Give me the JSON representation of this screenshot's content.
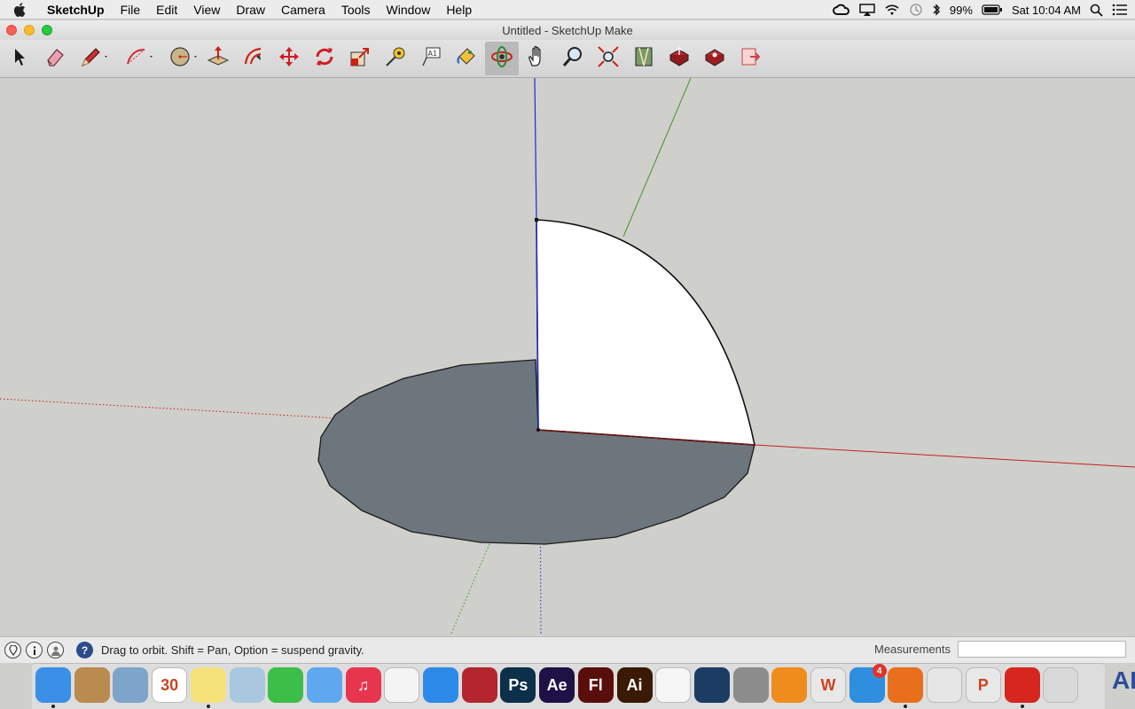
{
  "menubar": {
    "apple_icon": "apple-logo-icon",
    "app_name": "SketchUp",
    "items": [
      "File",
      "Edit",
      "View",
      "Draw",
      "Camera",
      "Tools",
      "Window",
      "Help"
    ],
    "status_icons": [
      "creative-cloud-icon",
      "airplay-icon",
      "wifi-icon",
      "time-machine-icon",
      "bluetooth-icon"
    ],
    "battery": "99%",
    "clock": "Sat 10:04 AM"
  },
  "window": {
    "title": "Untitled - SketchUp Make"
  },
  "toolbar": {
    "tools": [
      {
        "name": "select-tool",
        "icon": "arrow-pointer-icon",
        "active": false
      },
      {
        "name": "eraser-tool",
        "icon": "eraser-icon",
        "active": false
      },
      {
        "name": "pencil-line-tool",
        "icon": "pencil-icon",
        "active": false
      },
      {
        "name": "arc-tool",
        "icon": "arc-icon",
        "active": false
      },
      {
        "name": "circle-shapes-tool",
        "icon": "circle-icon",
        "active": false
      },
      {
        "name": "push-pull-tool",
        "icon": "push-pull-icon",
        "active": false
      },
      {
        "name": "offset-tool",
        "icon": "offset-icon",
        "active": false
      },
      {
        "name": "move-tool",
        "icon": "move-arrows-icon",
        "active": false
      },
      {
        "name": "rotate-tool",
        "icon": "rotate-icon",
        "active": false
      },
      {
        "name": "scale-tool",
        "icon": "scale-icon",
        "active": false
      },
      {
        "name": "tape-measure-tool",
        "icon": "tape-measure-icon",
        "active": false
      },
      {
        "name": "text-tool",
        "icon": "text-label-icon",
        "active": false
      },
      {
        "name": "paint-bucket-tool",
        "icon": "paint-bucket-icon",
        "active": false
      },
      {
        "name": "orbit-tool",
        "icon": "orbit-icon",
        "active": true
      },
      {
        "name": "pan-tool",
        "icon": "hand-icon",
        "active": false
      },
      {
        "name": "zoom-tool",
        "icon": "magnifier-icon",
        "active": false
      },
      {
        "name": "zoom-extents-tool",
        "icon": "zoom-extents-icon",
        "active": false
      },
      {
        "name": "warehouse-tool",
        "icon": "warehouse-icon",
        "active": false
      },
      {
        "name": "share-model-tool",
        "icon": "share-model-icon",
        "active": false
      },
      {
        "name": "extension-warehouse-tool",
        "icon": "extension-icon",
        "active": false
      },
      {
        "name": "send-to-layout-tool",
        "icon": "layout-icon",
        "active": false
      }
    ]
  },
  "statusbar": {
    "icons": [
      "geolocation-icon",
      "credits-icon",
      "user-icon"
    ],
    "help_icon": "help-icon",
    "help_symbol": "?",
    "message": "Drag to orbit. Shift = Pan, Option = suspend gravity.",
    "measurements_label": "Measurements",
    "measurements_value": ""
  },
  "scene": {
    "axis_colors": {
      "red": "#c81e1e",
      "green": "#3c9a2a",
      "blue": "#1a2ad0"
    },
    "base_disc_color": "#6e767d",
    "quarter_face_color": "#ffffff"
  },
  "dock": {
    "apps": [
      {
        "name": "finder",
        "label": "",
        "color": "#3b8fe6",
        "running": true,
        "badge": ""
      },
      {
        "name": "contacts",
        "label": "",
        "color": "#b98b4f",
        "running": false,
        "badge": ""
      },
      {
        "name": "preview",
        "label": "",
        "color": "#7da5c9",
        "running": false,
        "badge": ""
      },
      {
        "name": "calendar",
        "label": "30",
        "color": "#ffffff",
        "running": false,
        "badge": ""
      },
      {
        "name": "notes",
        "label": "",
        "color": "#f6e27a",
        "running": true,
        "badge": ""
      },
      {
        "name": "photo-viewer",
        "label": "",
        "color": "#a9c8e0",
        "running": false,
        "badge": ""
      },
      {
        "name": "facetime",
        "label": "",
        "color": "#3bbf48",
        "running": false,
        "badge": ""
      },
      {
        "name": "messages",
        "label": "",
        "color": "#5fa8f0",
        "running": false,
        "badge": ""
      },
      {
        "name": "itunes",
        "label": "♫",
        "color": "#e8354e",
        "running": false,
        "badge": ""
      },
      {
        "name": "reminders",
        "label": "",
        "color": "#f4f4f4",
        "running": false,
        "badge": ""
      },
      {
        "name": "safari",
        "label": "",
        "color": "#2d8ae8",
        "running": false,
        "badge": ""
      },
      {
        "name": "photo-booth",
        "label": "",
        "color": "#b3262d",
        "running": false,
        "badge": ""
      },
      {
        "name": "photoshop",
        "label": "Ps",
        "color": "#0c2f4a",
        "running": false,
        "badge": ""
      },
      {
        "name": "after-effects",
        "label": "Ae",
        "color": "#1f1146",
        "running": false,
        "badge": ""
      },
      {
        "name": "flash",
        "label": "Fl",
        "color": "#5a0e0b",
        "running": false,
        "badge": ""
      },
      {
        "name": "illustrator",
        "label": "Ai",
        "color": "#3a1a05",
        "running": false,
        "badge": ""
      },
      {
        "name": "photos",
        "label": "",
        "color": "#f6f6f6",
        "running": false,
        "badge": ""
      },
      {
        "name": "steam",
        "label": "",
        "color": "#1c3c64",
        "running": false,
        "badge": ""
      },
      {
        "name": "system-preferences",
        "label": "",
        "color": "#8c8c8c",
        "running": false,
        "badge": ""
      },
      {
        "name": "ibooks",
        "label": "",
        "color": "#f08c1c",
        "running": false,
        "badge": ""
      },
      {
        "name": "word",
        "label": "W",
        "color": "#e8e8e8",
        "running": false,
        "badge": ""
      },
      {
        "name": "app-store",
        "label": "",
        "color": "#2f8ee0",
        "running": false,
        "badge": "4"
      },
      {
        "name": "firefox",
        "label": "",
        "color": "#e8701c",
        "running": true,
        "badge": ""
      },
      {
        "name": "chrome",
        "label": "",
        "color": "#e6e6e6",
        "running": false,
        "badge": ""
      },
      {
        "name": "powerpoint",
        "label": "P",
        "color": "#e8e8e8",
        "running": false,
        "badge": ""
      },
      {
        "name": "sketchup",
        "label": "",
        "color": "#d7261f",
        "running": true,
        "badge": ""
      },
      {
        "name": "trash",
        "label": "",
        "color": "#d9d9d9",
        "running": false,
        "badge": ""
      }
    ],
    "edge_text": "AL"
  }
}
